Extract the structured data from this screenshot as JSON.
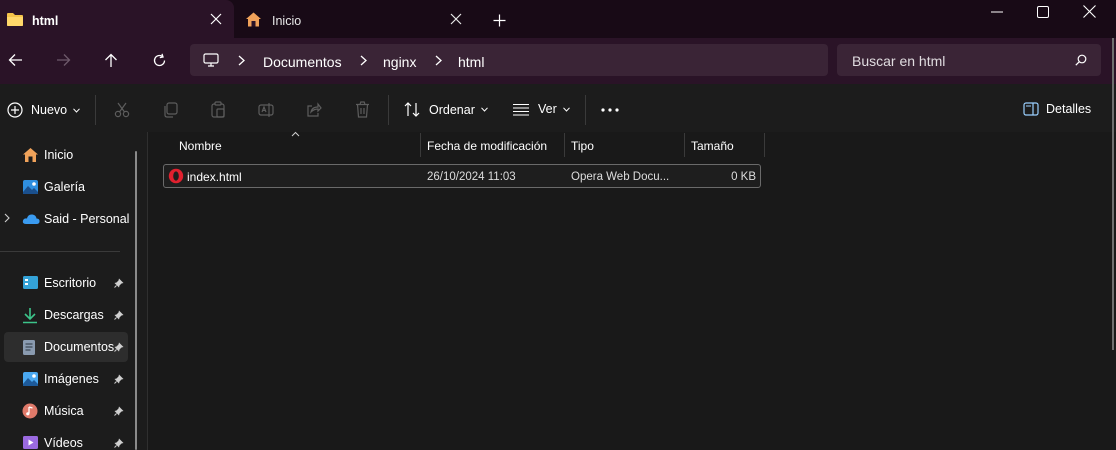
{
  "tabs": [
    {
      "label": "html",
      "icon": "folder-icon",
      "active": true
    },
    {
      "label": "Inicio",
      "icon": "home-icon",
      "active": false
    }
  ],
  "address": {
    "crumbs": [
      "Documentos",
      "nginx",
      "html"
    ]
  },
  "search": {
    "placeholder": "Buscar en html"
  },
  "commands": {
    "new_label": "Nuevo",
    "sort_label": "Ordenar",
    "view_label": "Ver",
    "details_label": "Detalles"
  },
  "sidebar": {
    "items": [
      {
        "label": "Inicio",
        "icon": "home-icon"
      },
      {
        "label": "Galería",
        "icon": "gallery-icon"
      },
      {
        "label": "Said - Personal",
        "icon": "onedrive-icon"
      },
      {
        "label": "Escritorio",
        "icon": "desktop-icon",
        "pinned": true
      },
      {
        "label": "Descargas",
        "icon": "download-icon",
        "pinned": true
      },
      {
        "label": "Documentos",
        "icon": "documents-icon",
        "pinned": true,
        "selected": true
      },
      {
        "label": "Imágenes",
        "icon": "pictures-icon",
        "pinned": true
      },
      {
        "label": "Música",
        "icon": "music-icon",
        "pinned": true
      },
      {
        "label": "Vídeos",
        "icon": "videos-icon",
        "pinned": true
      }
    ]
  },
  "columns": [
    "Nombre",
    "Fecha de modificación",
    "Tipo",
    "Tamaño"
  ],
  "files": [
    {
      "name": "index.html",
      "modified": "26/10/2024 11:03",
      "type": "Opera Web Docu...",
      "size": "0 KB",
      "icon": "opera-icon"
    }
  ],
  "colors": {
    "tab_bar": "#180a16",
    "active_tab": "#2a1327",
    "address_bg": "#3a2436",
    "content_bg": "#191919"
  }
}
